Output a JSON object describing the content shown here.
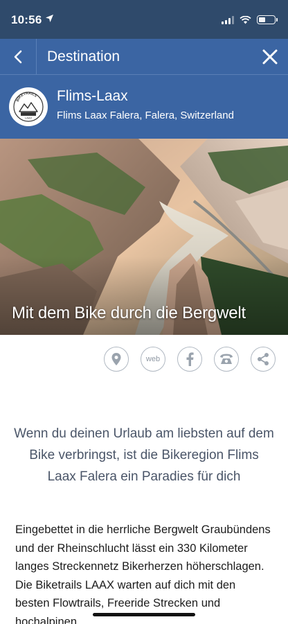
{
  "status_bar": {
    "time": "10:56"
  },
  "nav": {
    "title": "Destination"
  },
  "destination": {
    "name": "Flims-Laax",
    "location": "Flims Laax Falera, Falera, Switzerland",
    "logo_text": "BIKETRAILS LAAX"
  },
  "hero": {
    "caption": "Mit dem Bike durch die Bergwelt"
  },
  "actions": {
    "web_label": "web",
    "icons": [
      "map-pin-icon",
      "web-icon",
      "facebook-icon",
      "phone-icon",
      "share-icon"
    ]
  },
  "content": {
    "intro": "Wenn du deinen Urlaub am liebsten auf dem Bike verbringst, ist die Bikeregion Flims Laax Falera ein Paradies für dich",
    "body": "Eingebettet in die herrliche Bergwelt Graubündens und der Rheinschlucht lässt ein 330 Kilometer langes Streckennetz Bikerherzen höherschlagen. Die Biketrails LAAX warten auf dich mit den besten Flowtrails, Freeride Strecken und hochalpinen"
  },
  "colors": {
    "status_bar": "#2f4a6b",
    "header": "#3b65a3",
    "intro_text": "#4a5568"
  }
}
